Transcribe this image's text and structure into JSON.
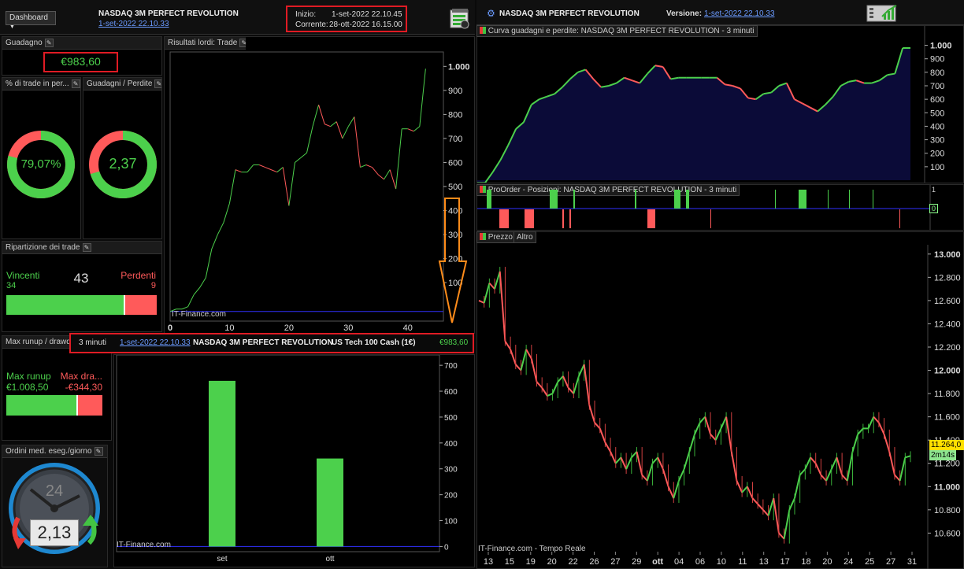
{
  "header": {
    "dashboard_label": "Dashboard",
    "strategy_title": "NASDAQ 3M PERFECT REVOLUTION",
    "strategy_date": "1-set-2022 22.10.33",
    "start_label": "Inizio:",
    "start_value": "1-set-2022 22.10.45",
    "current_label": "Corrente:",
    "current_value": "28-ott-2022 16.15.00",
    "right_title": "NASDAQ 3M PERFECT REVOLUTION",
    "version_label": "Versione:",
    "version_value": "1-set-2022 22.10.33"
  },
  "gain": {
    "title": "Guadagno",
    "value": "€983,60"
  },
  "pct_trades": {
    "title": "% di trade in per...",
    "value": "79,07%",
    "fraction": 0.7907
  },
  "gain_loss": {
    "title": "Guadagni / Perdite",
    "value": "2,37",
    "fraction": 0.703
  },
  "split": {
    "title": "Ripartizione dei trade",
    "win_label": "Vincenti",
    "win_count": "34",
    "total": "43",
    "loss_label": "Perdenti",
    "loss_count": "9"
  },
  "runup": {
    "title": "Max runup / drawdo",
    "runup_label": "Max runup",
    "runup_value": "€1.008,50",
    "dd_label": "Max dra...",
    "dd_value": "-€344,30",
    "runup_fraction": 0.745
  },
  "orders": {
    "title": "Ordini med. eseg./giorno",
    "dial_label": "24",
    "value": "2,13"
  },
  "gross": {
    "title": "Risultati lordi: Trade",
    "watermark": "IT-Finance.com"
  },
  "infobar": {
    "timeframe": "3 minuti",
    "date": "1-set-2022 22.10.33",
    "name": "NASDAQ 3M PERFECT REVOLUTION",
    "instrument": "US Tech 100 Cash (1€)",
    "value": "€983,60"
  },
  "monthly": {
    "watermark": "IT-Finance.com"
  },
  "equity_panel": {
    "title": "Curva guadagni e perdite: NASDAQ 3M PERFECT REVOLUTION - 3 minuti"
  },
  "positions_panel": {
    "title": "ProOrder - Posizioni: NASDAQ 3M PERFECT REVOLUTION - 3 minuti",
    "tick_top": "1",
    "tick_zero": "0"
  },
  "price_panel": {
    "tab_price": "Prezzo",
    "tab_other": "Altro",
    "last_price": "11.264,0",
    "countdown": "2m14s",
    "watermark": "IT-Finance.com - Tempo Reale"
  },
  "colors": {
    "profit": "#4cd04c",
    "loss": "#ff5a5a",
    "accent_red": "#e01b24",
    "link": "#6b9bff"
  },
  "chart_data": [
    {
      "type": "line",
      "title": "Risultati lordi: Trade",
      "x": [
        0,
        1,
        2,
        3,
        4,
        5,
        6,
        7,
        8,
        9,
        10,
        11,
        12,
        13,
        14,
        15,
        16,
        17,
        18,
        19,
        20,
        21,
        22,
        23,
        24,
        25,
        26,
        27,
        28,
        29,
        30,
        31,
        32,
        33,
        34,
        35,
        36,
        37,
        38,
        39,
        40,
        41,
        42,
        43
      ],
      "y": [
        -20,
        -10,
        -10,
        0,
        50,
        80,
        120,
        240,
        300,
        350,
        430,
        570,
        560,
        560,
        590,
        590,
        580,
        570,
        560,
        580,
        420,
        600,
        620,
        640,
        750,
        840,
        760,
        750,
        770,
        700,
        750,
        790,
        580,
        590,
        580,
        550,
        530,
        570,
        490,
        740,
        740,
        730,
        750,
        990
      ],
      "xticks": [
        0,
        10,
        20,
        30,
        40
      ],
      "yticks": [
        100,
        200,
        300,
        400,
        500,
        600,
        700,
        800,
        900,
        1000
      ],
      "ytick_labels": [
        "100",
        "200",
        "300",
        "400",
        "500",
        "600",
        "700",
        "800",
        "900",
        "1.000"
      ],
      "xlim": [
        0,
        46
      ],
      "ylim": [
        -60,
        1060
      ]
    },
    {
      "type": "bar",
      "categories": [
        "set",
        "ott"
      ],
      "values": [
        640,
        340
      ],
      "yticks": [
        0,
        100,
        200,
        300,
        400,
        500,
        600,
        700
      ],
      "ylim": [
        -20,
        740
      ]
    },
    {
      "type": "line",
      "title": "Curva guadagni e perdite: NASDAQ 3M PERFECT REVOLUTION - 3 minuti",
      "yticks": [
        100,
        200,
        300,
        400,
        500,
        600,
        700,
        800,
        900,
        1000
      ],
      "ytick_labels": [
        "100",
        "200",
        "300",
        "400",
        "500",
        "600",
        "700",
        "800",
        "900",
        "1.000"
      ],
      "ylim": [
        0,
        1050
      ],
      "y": [
        -20,
        -20,
        60,
        150,
        260,
        380,
        430,
        560,
        600,
        620,
        640,
        690,
        750,
        800,
        820,
        750,
        690,
        700,
        720,
        760,
        740,
        720,
        790,
        850,
        840,
        750,
        760,
        760,
        760,
        760,
        760,
        760,
        710,
        700,
        680,
        610,
        600,
        640,
        650,
        700,
        720,
        600,
        570,
        540,
        510,
        560,
        620,
        700,
        730,
        740,
        720,
        720,
        740,
        780,
        790,
        980,
        980
      ]
    },
    {
      "type": "line",
      "title": "Prezzo",
      "yticks": [
        10600,
        10800,
        11000,
        11200,
        11400,
        11600,
        11800,
        12000,
        12200,
        12400,
        12600,
        12800,
        13000
      ],
      "ytick_labels": [
        "10.600",
        "10.800",
        "11.000",
        "11.200",
        "11.400",
        "11.600",
        "11.800",
        "12.000",
        "12.200",
        "12.400",
        "12.600",
        "12.800",
        "13.000"
      ],
      "ylim": [
        10440,
        13080
      ],
      "xtick_labels": [
        "13",
        "15",
        "19",
        "20",
        "22",
        "26",
        "27",
        "29",
        "ott",
        "04",
        "06",
        "10",
        "11",
        "13",
        "17",
        "18",
        "20",
        "24",
        "25",
        "27",
        "31"
      ],
      "y": [
        12600,
        12580,
        12750,
        12700,
        12850,
        12250,
        12180,
        12050,
        12000,
        12180,
        12100,
        11900,
        11850,
        11780,
        11800,
        11900,
        11950,
        11850,
        11800,
        11950,
        12050,
        11700,
        11550,
        11500,
        11380,
        11300,
        11200,
        11250,
        11150,
        11250,
        11300,
        11100,
        11050,
        11200,
        11250,
        11150,
        11000,
        10900,
        11050,
        11150,
        11300,
        11450,
        11550,
        11600,
        11450,
        11400,
        11500,
        11600,
        11300,
        11050,
        10950,
        11000,
        10900,
        10850,
        10800,
        10750,
        10900,
        10600,
        10550,
        10800,
        10900,
        11100,
        11150,
        11250,
        11200,
        11100,
        11050,
        11150,
        11250,
        11100,
        11050,
        11300,
        11450,
        11500,
        11500,
        11600,
        11550,
        11450,
        11300,
        11100,
        11050,
        11250,
        11264
      ]
    }
  ]
}
